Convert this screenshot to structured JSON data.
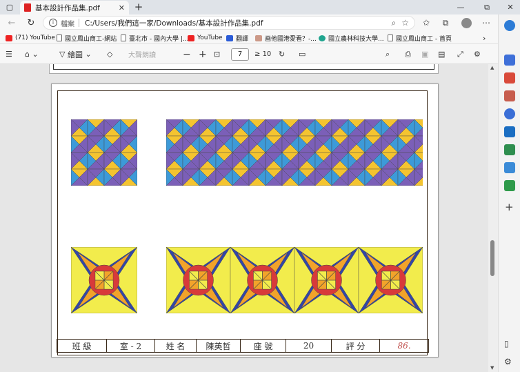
{
  "tab": {
    "title": "基本設計作品集.pdf",
    "close": "✕",
    "new": "+"
  },
  "window": {
    "minimize": "—",
    "restore": "⧉",
    "close": "✕"
  },
  "address": {
    "view_label": "檔案",
    "url": "C:/Users/我們這一家/Downloads/基本設計作品集.pdf"
  },
  "bookmarks": [
    {
      "label": "(71) YouTube",
      "icon": "youtube-icon"
    },
    {
      "label": "國立鳳山商工-網站",
      "icon": "page-icon"
    },
    {
      "label": "臺北市 - 國內大學 |...",
      "icon": "page-icon"
    },
    {
      "label": "YouTube",
      "icon": "youtube-icon"
    },
    {
      "label": "翻譯",
      "icon": "translate-icon"
    },
    {
      "label": "画他國港愛看？-...",
      "icon": "tree-icon"
    },
    {
      "label": "國立農林科技大學...",
      "icon": "globe-icon"
    },
    {
      "label": "國立鳳山商工 - 首頁",
      "icon": "page-icon"
    }
  ],
  "pdf_toolbar": {
    "draw_label": "繪圖",
    "read_aloud_label": "大聲朗讀",
    "page_current": "7",
    "page_total": "10"
  },
  "info_table": {
    "class_label": "班 級",
    "class_value": "室 - 2",
    "name_label": "姓 名",
    "name_value": "陳英哲",
    "seat_label": "座 號",
    "seat_value": "20",
    "score_label": "評 分",
    "score_value": "86."
  },
  "colors": {
    "purple": "#7b5fb8",
    "blue": "#3d9ad8",
    "yellow": "#f4c430",
    "lemon": "#f2ec4c",
    "navy": "#3346a6",
    "red": "#d83a3a",
    "orange": "#f2a32a"
  }
}
